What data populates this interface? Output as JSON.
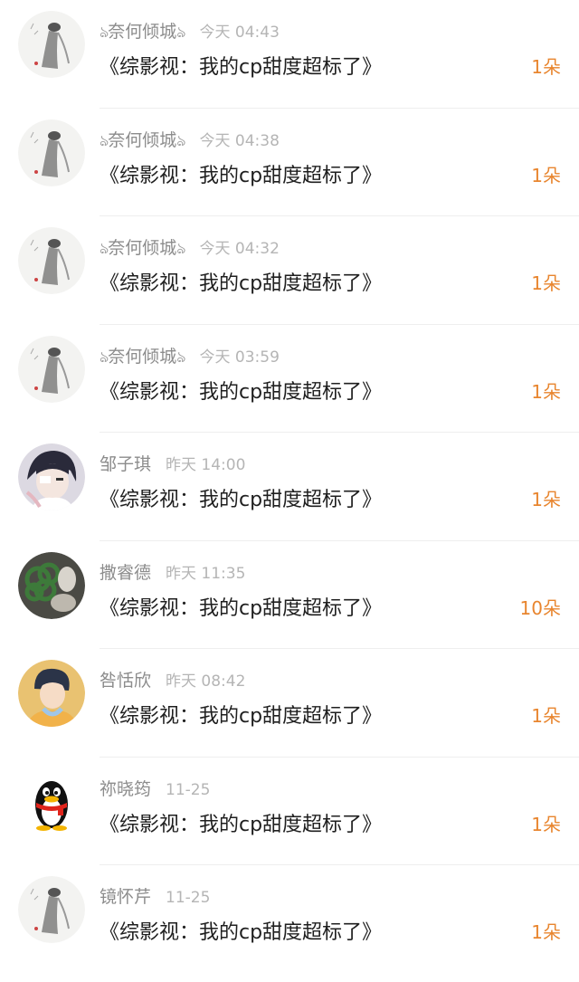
{
  "rows": [
    {
      "deco_left": "ঌ",
      "name": "奈何倾城",
      "deco_right": "ঌ",
      "time": "今天 04:43",
      "title": "《综影视：我的cp甜度超标了》",
      "count": "1朵",
      "avatar": "ink-painting-icon"
    },
    {
      "deco_left": "ঌ",
      "name": "奈何倾城",
      "deco_right": "ঌ",
      "time": "今天 04:38",
      "title": "《综影视：我的cp甜度超标了》",
      "count": "1朵",
      "avatar": "ink-painting-icon"
    },
    {
      "deco_left": "ঌ",
      "name": "奈何倾城",
      "deco_right": "ঌ",
      "time": "今天 04:32",
      "title": "《综影视：我的cp甜度超标了》",
      "count": "1朵",
      "avatar": "ink-painting-icon"
    },
    {
      "deco_left": "ঌ",
      "name": "奈何倾城",
      "deco_right": "ঌ",
      "time": "今天 03:59",
      "title": "《综影视：我的cp甜度超标了》",
      "count": "1朵",
      "avatar": "ink-painting-icon"
    },
    {
      "name": "邹子琪",
      "time": "昨天 14:00",
      "title": "《综影视：我的cp甜度超标了》",
      "count": "1朵",
      "avatar": "anime-boy-icon"
    },
    {
      "name": "撒睿德",
      "time": "昨天 11:35",
      "title": "《综影视：我的cp甜度超标了》",
      "count": "10朵",
      "avatar": "green-flower-icon"
    },
    {
      "name": "咎恬欣",
      "time": "昨天 08:42",
      "title": "《综影视：我的cp甜度超标了》",
      "count": "1朵",
      "avatar": "illustrated-boy-icon"
    },
    {
      "name": "祢晓筠",
      "time": "11-25",
      "title": "《综影视：我的cp甜度超标了》",
      "count": "1朵",
      "avatar": "qq-penguin-icon"
    },
    {
      "name": "镜怀芹",
      "time": "11-25",
      "title": "《综影视：我的cp甜度超标了》",
      "count": "1朵",
      "avatar": "ink-painting-icon"
    }
  ],
  "colors": {
    "accent": "#e8852e",
    "name": "#8c8c8c",
    "time": "#b5b5b5",
    "title": "#1f1f1f",
    "divider": "#eeeeee"
  }
}
